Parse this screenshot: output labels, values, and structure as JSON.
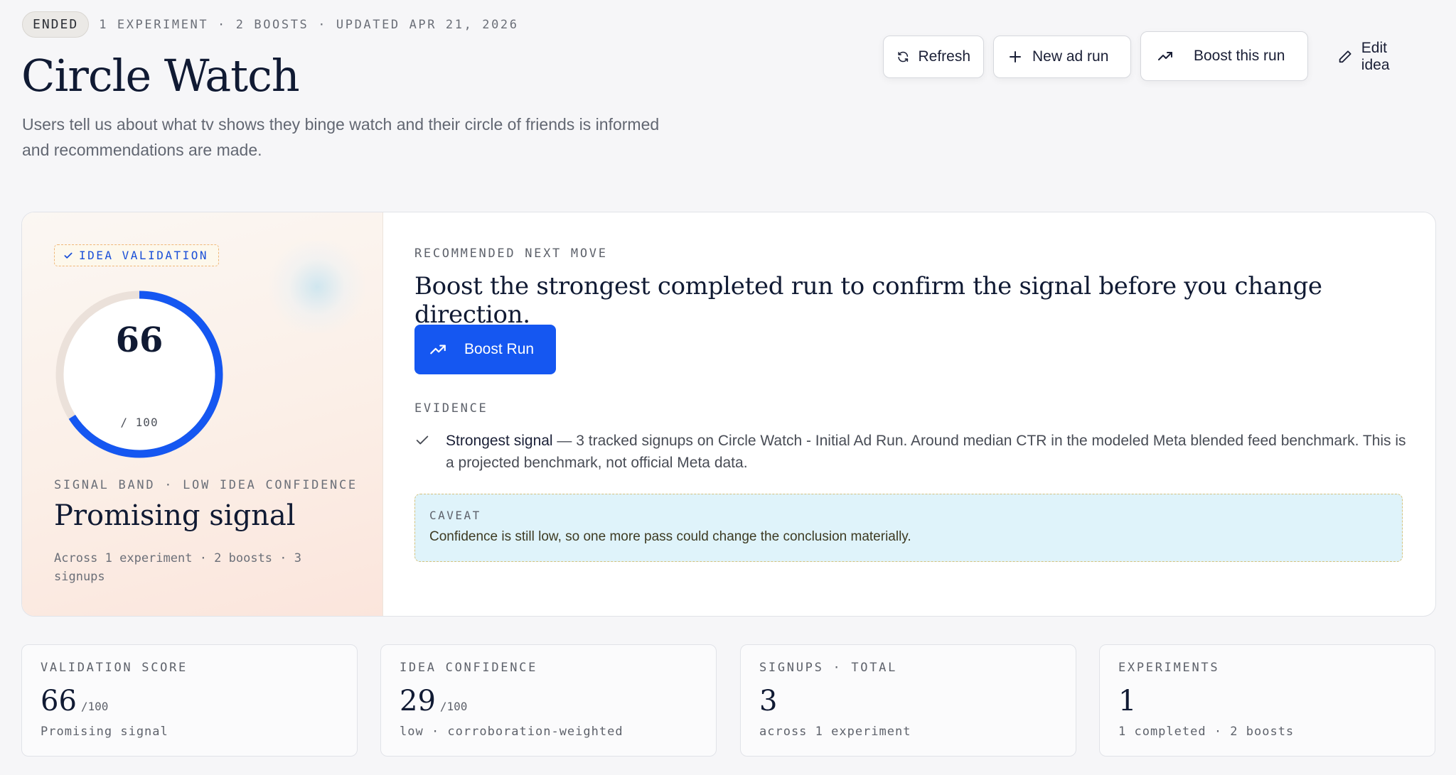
{
  "header": {
    "status": "ENDED",
    "meta": "1 EXPERIMENT · 2 BOOSTS · UPDATED APR 21, 2026",
    "title": "Circle Watch",
    "description": "Users tell us about what tv shows they binge watch and their circle of friends is informed and recommendations are made."
  },
  "actions": {
    "refresh": "Refresh",
    "new_ad_run": "New ad run",
    "boost_this_run": "Boost this run",
    "edit_idea": "Edit idea"
  },
  "score_panel": {
    "tag": "IDEA VALIDATION",
    "score": "66",
    "score_max": "/ 100",
    "score_fraction": 0.66,
    "band_label": "SIGNAL BAND · LOW IDEA CONFIDENCE",
    "band_value": "Promising signal",
    "note": "Across 1 experiment · 2 boosts · 3 signups"
  },
  "recommendation": {
    "label": "RECOMMENDED NEXT MOVE",
    "headline": "Boost the strongest completed run to confirm the signal before you change direction.",
    "button": "Boost Run",
    "evidence_label": "EVIDENCE",
    "evidence_title": "Strongest signal",
    "evidence_text": " — 3 tracked signups on Circle Watch - Initial Ad Run. Around median CTR in the modeled Meta blended feed benchmark. This is a projected benchmark, not official Meta data.",
    "caveat_label": "CAVEAT",
    "caveat_text": "Confidence is still low, so one more pass could change the conclusion materially."
  },
  "stats": [
    {
      "label": "VALIDATION SCORE",
      "value": "66",
      "unit": "/100",
      "sub": "Promising signal"
    },
    {
      "label": "IDEA CONFIDENCE",
      "value": "29",
      "unit": "/100",
      "sub": "low · corroboration-weighted"
    },
    {
      "label": "SIGNUPS · TOTAL",
      "value": "3",
      "unit": "",
      "sub": "across 1 experiment"
    },
    {
      "label": "EXPERIMENTS",
      "value": "1",
      "unit": "",
      "sub": "1 completed · 2 boosts"
    }
  ],
  "colors": {
    "accent": "#1557f1",
    "gauge_track": "#ebe1da",
    "caveat_bg": "#dff3fa"
  }
}
